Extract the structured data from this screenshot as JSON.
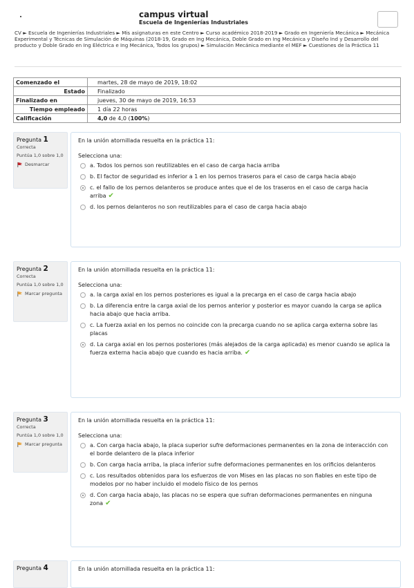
{
  "header": {
    "title": "campus virtual",
    "subtitle": "Escuela de Ingenierías Industriales"
  },
  "breadcrumb": "CV ► Escuela de Ingenierías Industriales ► Mis asignaturas en este Centro ► Curso académico 2018-2019 ► Grado en Ingeniería Mecánica ► Mecánica Experimental y Técnicas de Simulación de Máquinas (2018-19, Grado en Ing Mecánica, Doble Grado en Ing Mecánica y Diseño Ind y Desarrollo del producto y Doble Grado en Ing Eléctrica e Ing Mecánica, Todos los grupos) ► Simulación Mecánica mediante el MEF ► Cuestiones de la Práctica 11",
  "summary": [
    {
      "label": "Comenzado el",
      "value": "martes, 28 de mayo de 2019, 18:02"
    },
    {
      "label": "Estado",
      "value": "Finalizado"
    },
    {
      "label": "Finalizado en",
      "value": "jueves, 30 de mayo de 2019, 16:53"
    },
    {
      "label": "Tiempo empleado",
      "value": "1 día 22 horas"
    },
    {
      "label": "Calificación",
      "value_bold": "4,0",
      "value_mid": " de 4,0 (",
      "value_pct": "100%",
      "value_end": ")"
    }
  ],
  "questions": [
    {
      "label": "Pregunta",
      "number": "1",
      "state": "Correcta",
      "score": "Puntúa 1,0 sobre 1,0",
      "flag_label": "Desmarcar",
      "text": "En la unión atornillada resuelta en la práctica 11:",
      "prompt": "Selecciona una:",
      "answers": [
        "a. Todos los pernos son reutilizables en el caso de carga hacia arriba",
        "b. El factor de seguridad es inferior a 1 en los pernos traseros para el caso de carga hacia abajo",
        "c. el fallo de los pernos delanteros se produce antes que el de los traseros en el caso de carga hacia arriba",
        "d. los pernos delanteros no son reutilizables para el caso de carga hacia abajo"
      ],
      "selected": 2
    },
    {
      "label": "Pregunta",
      "number": "2",
      "state": "Correcta",
      "score": "Puntúa 1,0 sobre 1,0",
      "flag_label": "Marcar pregunta",
      "text": "En la unión atornillada resuelta en la práctica 11:",
      "prompt": "Selecciona una:",
      "answers": [
        "a. la carga axial en los pernos posteriores es igual a la precarga en el caso de carga hacia abajo",
        "b. La diferencia entre la carga axial de los pernos anterior y posterior es mayor cuando la carga se aplica hacia abajo que hacia arriba.",
        "c. La fuerza axial en los pernos no coincide con la precarga cuando no se aplica carga externa sobre las placas",
        "d. La carga axial en los pernos posteriores (más alejados de la carga aplicada) es menor cuando se aplica la fuerza externa hacia abajo que cuando es hacia arriba."
      ],
      "selected": 3
    },
    {
      "label": "Pregunta",
      "number": "3",
      "state": "Correcta",
      "score": "Puntúa 1,0 sobre 1,0",
      "flag_label": "Marcar pregunta",
      "text": "En la unión atornillada resuelta en la práctica 11:",
      "prompt": "Selecciona una:",
      "answers": [
        "a. Con carga hacia abajo, la placa superior sufre deformaciones permanentes en la zona de interacción con el borde delantero de la placa inferior",
        "b. Con carga hacia arriba, la placa inferior sufre deformaciones permanentes en los orificios delanteros",
        "c. Los resultados obtenidos para los esfuerzos de von Mises en las placas no son fiables en este tipo de modelos por no haber incluido el modelo físico de los pernos",
        "d. Con carga hacia abajo, las placas no se espera que sufran deformaciones permanentes en ninguna zona"
      ],
      "selected": 3
    },
    {
      "label": "Pregunta",
      "number": "4",
      "text": "En la unión atornillada resuelta en la práctica 11:"
    }
  ],
  "colors": {
    "tick": "#6bbf3a",
    "flag_red": "#c0282d",
    "flag_orange": "#e8a23a"
  }
}
